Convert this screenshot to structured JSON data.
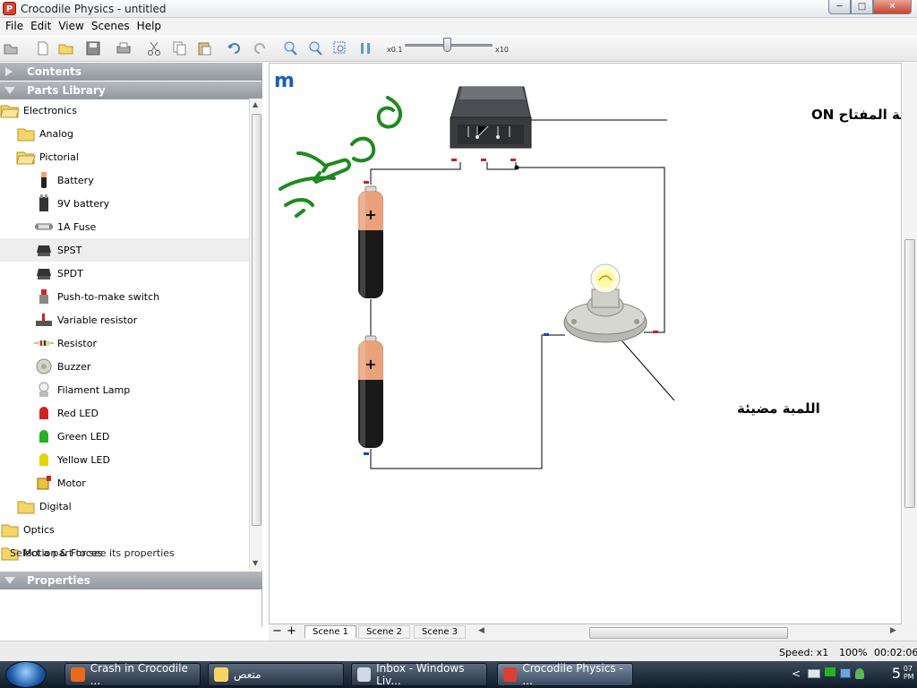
{
  "window": {
    "title": "Crocodile Physics - untitled",
    "app_icon_letter": "P"
  },
  "menu": [
    "File",
    "Edit",
    "View",
    "Scenes",
    "Help"
  ],
  "toolbar": {
    "speed_min": "x0.1",
    "speed_max": "x10"
  },
  "panels": {
    "contents": "Contents",
    "parts_library": "Parts Library",
    "properties": "Properties"
  },
  "tree": [
    {
      "label": "Electronics",
      "icon": "folder-open-icon",
      "level": 0
    },
    {
      "label": "Analog",
      "icon": "folder-icon",
      "level": 1
    },
    {
      "label": "Pictorial",
      "icon": "folder-open-icon",
      "level": 1
    },
    {
      "label": "Battery",
      "icon": "battery-icon",
      "level": 2
    },
    {
      "label": "9V battery",
      "icon": "9v-battery-icon",
      "level": 2
    },
    {
      "label": "1A Fuse",
      "icon": "fuse-icon",
      "level": 2
    },
    {
      "label": "SPST",
      "icon": "spst-switch-icon",
      "level": 2,
      "selected": true
    },
    {
      "label": "SPDT",
      "icon": "spdt-switch-icon",
      "level": 2
    },
    {
      "label": "Push-to-make switch",
      "icon": "push-switch-icon",
      "level": 2
    },
    {
      "label": "Variable resistor",
      "icon": "variable-resistor-icon",
      "level": 2
    },
    {
      "label": "Resistor",
      "icon": "resistor-icon",
      "level": 2
    },
    {
      "label": "Buzzer",
      "icon": "buzzer-icon",
      "level": 2
    },
    {
      "label": "Filament Lamp",
      "icon": "lamp-icon",
      "level": 2
    },
    {
      "label": "Red LED",
      "icon": "red-led-icon",
      "level": 2
    },
    {
      "label": "Green LED",
      "icon": "green-led-icon",
      "level": 2
    },
    {
      "label": "Yellow LED",
      "icon": "yellow-led-icon",
      "level": 2
    },
    {
      "label": "Motor",
      "icon": "motor-icon",
      "level": 2
    },
    {
      "label": "Digital",
      "icon": "folder-icon",
      "level": 1
    },
    {
      "label": "Optics",
      "icon": "folder-icon",
      "level": 0
    },
    {
      "label": "Motion & Forces",
      "icon": "folder-icon",
      "level": 0
    }
  ],
  "properties_text": "Select a part to see its properties",
  "canvas": {
    "logo_letter": "m",
    "switch_caption": "فى حالة المفتاح ON",
    "lamp_caption": "اللمبة مضيئة"
  },
  "scenes": [
    "Scene 1",
    "Scene 2",
    "Scene 3"
  ],
  "status": {
    "speed": "Speed: x1",
    "zoom": "100%",
    "time": "00:02:06"
  },
  "taskbar": {
    "tasks": [
      {
        "label": "Crash in Crocodile ...",
        "icon": "firefox-icon"
      },
      {
        "label": "متعص",
        "icon": "folder-icon"
      },
      {
        "label": "Inbox - Windows Liv...",
        "icon": "mail-icon"
      },
      {
        "label": "Crocodile Physics - ...",
        "icon": "crocodile-app-icon",
        "active": true
      }
    ],
    "clock": {
      "hour": "5",
      "minutes": "07",
      "ampm": "PM"
    }
  },
  "colors": {
    "accent_selected": "#eeeeee",
    "wire": "#000000",
    "battery_copper": "#e9a27a",
    "led_red": "#d42020",
    "led_green": "#24b024",
    "led_yellow": "#e2d400",
    "scribble_green": "#1d8a1d"
  }
}
